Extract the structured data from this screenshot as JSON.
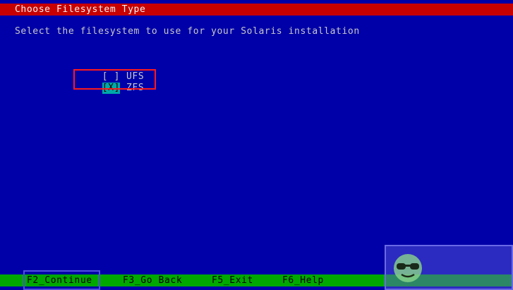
{
  "screen": {
    "title": "Choose Filesystem Type",
    "instruction": "Select the filesystem to use for your Solaris installation"
  },
  "options": [
    {
      "box": "[ ]",
      "label": "UFS",
      "selected": false
    },
    {
      "box": "[X]",
      "label": "ZFS",
      "selected": true
    }
  ],
  "footer": {
    "keys": [
      "F2_Continue",
      "F3_Go Back",
      "F5_Exit",
      "F6_Help"
    ]
  },
  "colors": {
    "background": "#0000a8",
    "title_bar": "#c80000",
    "footer_bar": "#00a800",
    "selection": "#00a8a8",
    "highlight_red": "#ff1a1a",
    "highlight_blue": "#4f4fe0"
  },
  "icons": [
    "sunglasses-face-icon"
  ]
}
